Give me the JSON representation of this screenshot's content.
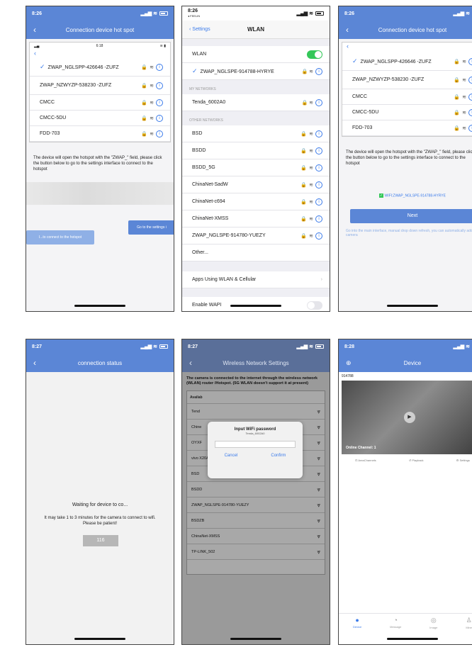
{
  "colors": {
    "accent": "#5b86d6",
    "toggle_on": "#34c759",
    "ios_blue": "#3b7bea"
  },
  "s1": {
    "time": "8:26",
    "title": "Connection device hot spot",
    "inner_time": "6:18",
    "networks": [
      {
        "name": "ZWAP_NGLSPP-426646 -ZUFZ",
        "checked": true
      },
      {
        "name": "ZWAP_NZWYZP-538230 -ZUFZ",
        "checked": false
      },
      {
        "name": "CMCC",
        "checked": false
      },
      {
        "name": "CMCC-5DU",
        "checked": false
      },
      {
        "name": "FDD-703",
        "checked": false
      }
    ],
    "note": "The device will open the hotspot with the \"ZWAP_\" field, please click the button below to go to the settings interface to connect to the hotspot",
    "go_settings": "Go to the settings i",
    "connect_hotspot": "I...to connect to the hotspot"
  },
  "s2": {
    "time": "8:26",
    "sub": "◂ FEELIN",
    "back": "Settings",
    "title": "WLAN",
    "wlan_label": "WLAN",
    "connected": "ZWAP_NGLSPE-914788-HYRYE",
    "my_networks": "MY NETWORKS",
    "my_network": "Tenda_6002A0",
    "other_networks": "OTHER NETWORKS",
    "others": [
      "BSD",
      "BSDD",
      "BSDD_5G",
      "ChinaNet-SadW",
      "ChinaNet-c694",
      "ChinaNet-XMSS",
      "ZWAP_NGLSPE-914780-YUEZY"
    ],
    "other": "Other...",
    "apps": "Apps Using WLAN & Cellular",
    "ask": "Enable WAPI"
  },
  "s3": {
    "time": "8:26",
    "title": "Connection device hot spot",
    "networks": [
      {
        "name": "ZWAP_NGLSPP-426646 -ZUFZ",
        "checked": true
      },
      {
        "name": "ZWAP_NZWYZP-538230 -ZUFZ",
        "checked": false
      },
      {
        "name": "CMCC",
        "checked": false
      },
      {
        "name": "CMCC-5DU",
        "checked": false
      },
      {
        "name": "FDD-703",
        "checked": false
      }
    ],
    "note": "The device will open the hotspot with the \"ZWAP_\" field, please click the button below to go to the settings interface to connect to the hotspot",
    "wifi_status": "WIFI:ZWAP_NGLSPE-914788-HYRYE",
    "next": "Next",
    "foot": "Go into the main interface, manual drop down refresh, you can automatically add a camera"
  },
  "s4": {
    "time": "8:27",
    "title": "connection status",
    "waiting": "Waiting for device to co...",
    "detail": "It may take 1 to 3 minutes for the camera to connect to wifi. Please be patient!",
    "countdown": "116"
  },
  "s5": {
    "time": "8:27",
    "title": "Wireless Network Settings",
    "intro": "The camera is connected to the internet through the wireless network (WLAN) router /Hotspot. (5G WLAN doesn't support it at present)",
    "available": "Availab",
    "list": [
      "Tend",
      "Chine",
      "OYXF",
      "vivo X20A",
      "BSD",
      "BSDD",
      "ZWAP_NGLSPE-914780-YUEZY",
      "BSDZB",
      "ChinaNet-XMSS",
      "TP-LINK_502"
    ],
    "modal_title": "Input WiFi password",
    "modal_sub": "Tenda_6002A0",
    "cancel": "Cancel",
    "confirm": "Confirm"
  },
  "s6": {
    "time": "8:28",
    "title": "Device",
    "device_id": "914788",
    "online": "Online Channel: 1",
    "actions": [
      "AreaChannels",
      "Playback",
      "Settings"
    ],
    "tabs": [
      "Device",
      "Message",
      "Image",
      "Mine"
    ]
  }
}
